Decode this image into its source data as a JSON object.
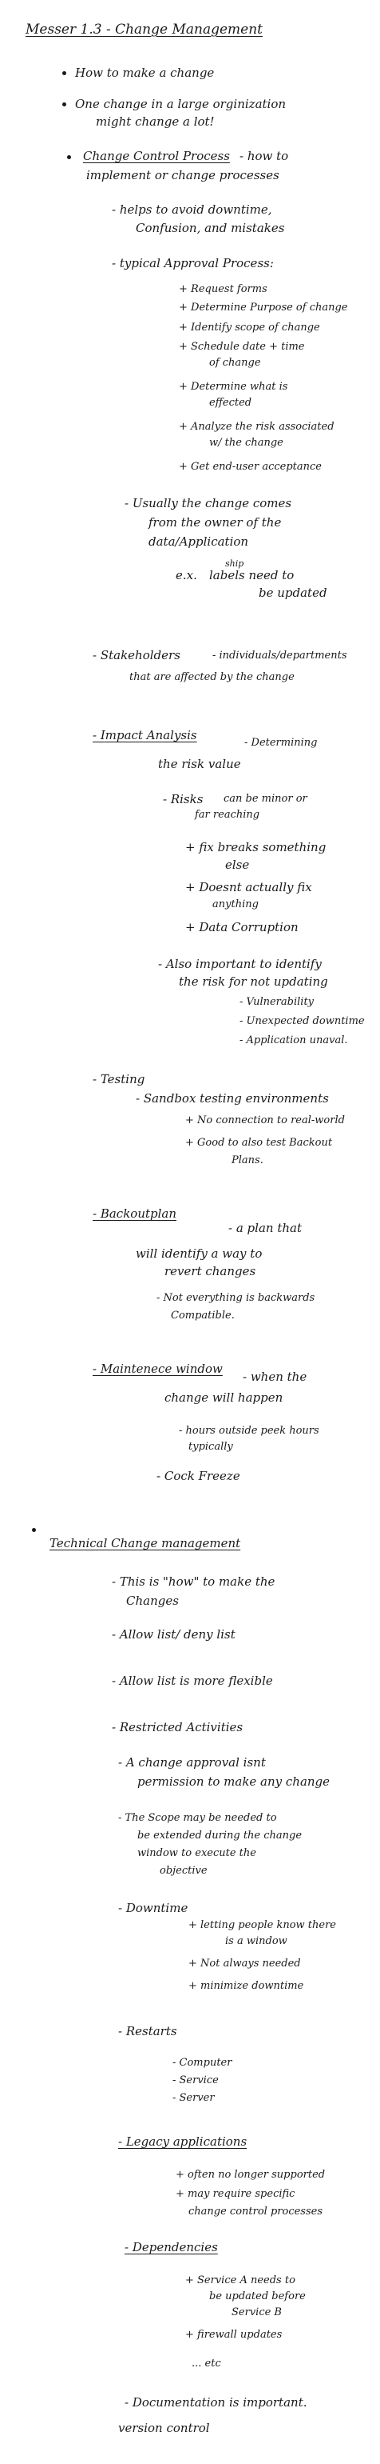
{
  "title": "Messer 1.3 - Change Management",
  "lines": [
    "How to make a change",
    "One change in a large orginization",
    "might change a lot!",
    "Change Control Process",
    "- how to",
    "implement or change processes",
    "- helps to avoid downtime,",
    "Confusion, and mistakes",
    "- typical Approval Process:",
    "+ Request forms",
    "+ Determine Purpose of change",
    "+ Identify scope of change",
    "+ Schedule date + time",
    "of change",
    "+ Determine what is",
    "effected",
    "+ Analyze the risk associated",
    "w/ the change",
    "+ Get end-user acceptance",
    "- Usually the change comes",
    "from the owner of the",
    "data/Application",
    "e.x.",
    "ship",
    "labels need to",
    "be updated",
    "- Stakeholders",
    "- individuals/departments",
    "that are affected by the change",
    "- Impact Analysis",
    "- Determining",
    "the risk value",
    "- Risks",
    "can be minor or",
    "far reaching",
    "+ fix breaks something",
    "else",
    "+ Doesnt actually fix",
    "anything",
    "+ Data Corruption",
    "- Also important to identify",
    "the risk for not updating",
    "- Vulnerability",
    "- Unexpected downtime",
    "- Application unaval.",
    "- Testing",
    "- Sandbox testing environments",
    "+ No connection to real-world",
    "+ Good to also test Backout",
    "Plans.",
    "- Backoutplan",
    "- a plan that",
    "will identify a way to",
    "revert changes",
    "- Not everything is backwards",
    "Compatible.",
    "- Maintenece window",
    "- when the",
    "change will happen",
    "- hours outside peek hours",
    "typically",
    "- Cock Freeze",
    "Technical Change management",
    "- This is \"how\" to make the",
    "Changes",
    "- Allow list/ deny list",
    "- Allow list is more flexible",
    "- Restricted Activities",
    "- A change approval isnt",
    "permission to make any change",
    "- The Scope may be needed to",
    "be extended during the change",
    "window to execute the",
    "objective",
    "- Downtime",
    "+ letting people know there",
    "is a window",
    "+ Not always needed",
    "+ minimize downtime",
    "- Restarts",
    "- Computer",
    "- Service",
    "- Server",
    "- Legacy applications",
    "+ often no longer supported",
    "+ may require specific",
    "change control processes",
    "- Dependencies",
    "+ Service A needs to",
    "be updated before",
    "Service B",
    "+ firewall updates",
    "... etc",
    "- Documentation is important.",
    "version control"
  ]
}
